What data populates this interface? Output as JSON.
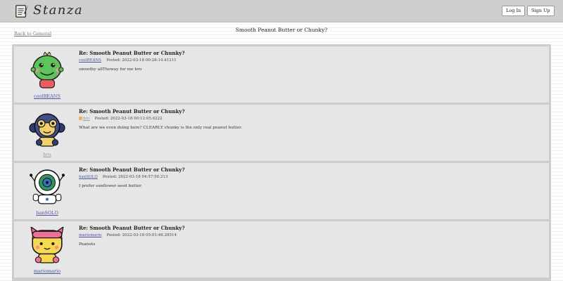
{
  "app": {
    "name": "Stanza"
  },
  "header": {
    "login_label": "Log In",
    "signup_label": "Sign Up"
  },
  "thread": {
    "back_label": "Back to General",
    "title": "Smooth Peanut Butter or Chunky?"
  },
  "posts": [
    {
      "subject": "Re: Smooth Peanut Butter or Chunky?",
      "author": "coolBEANS",
      "posted": "Posted: 2022-03-18 00:28:14.41211",
      "body": "smoothy allTheway for me bro",
      "avatar_icon": "green-dinosaur-avatar-icon"
    },
    {
      "subject": "Re: Smooth Peanut Butter or Chunky?",
      "author": "bro",
      "posted": "Posted: 2022-03-18 00:12:05.0222",
      "body": "What are we even doing here? CLEARLY chunky is the only real peanut butter.",
      "avatar_icon": "monkey-avatar-icon"
    },
    {
      "subject": "Re: Smooth Peanut Butter or Chunky?",
      "author": "hanSOLO",
      "posted": "Posted: 2022-03-18 04:57:50.213",
      "body": "I prefer sunflower seed butter.",
      "avatar_icon": "robot-avatar-icon"
    },
    {
      "subject": "Re: Smooth Peanut Butter or Chunky?",
      "author": "mariomario",
      "posted": "Posted: 2022-03-18 05:01:46.28514",
      "body": "Peanuts",
      "avatar_icon": "pink-cat-avatar-icon"
    }
  ]
}
